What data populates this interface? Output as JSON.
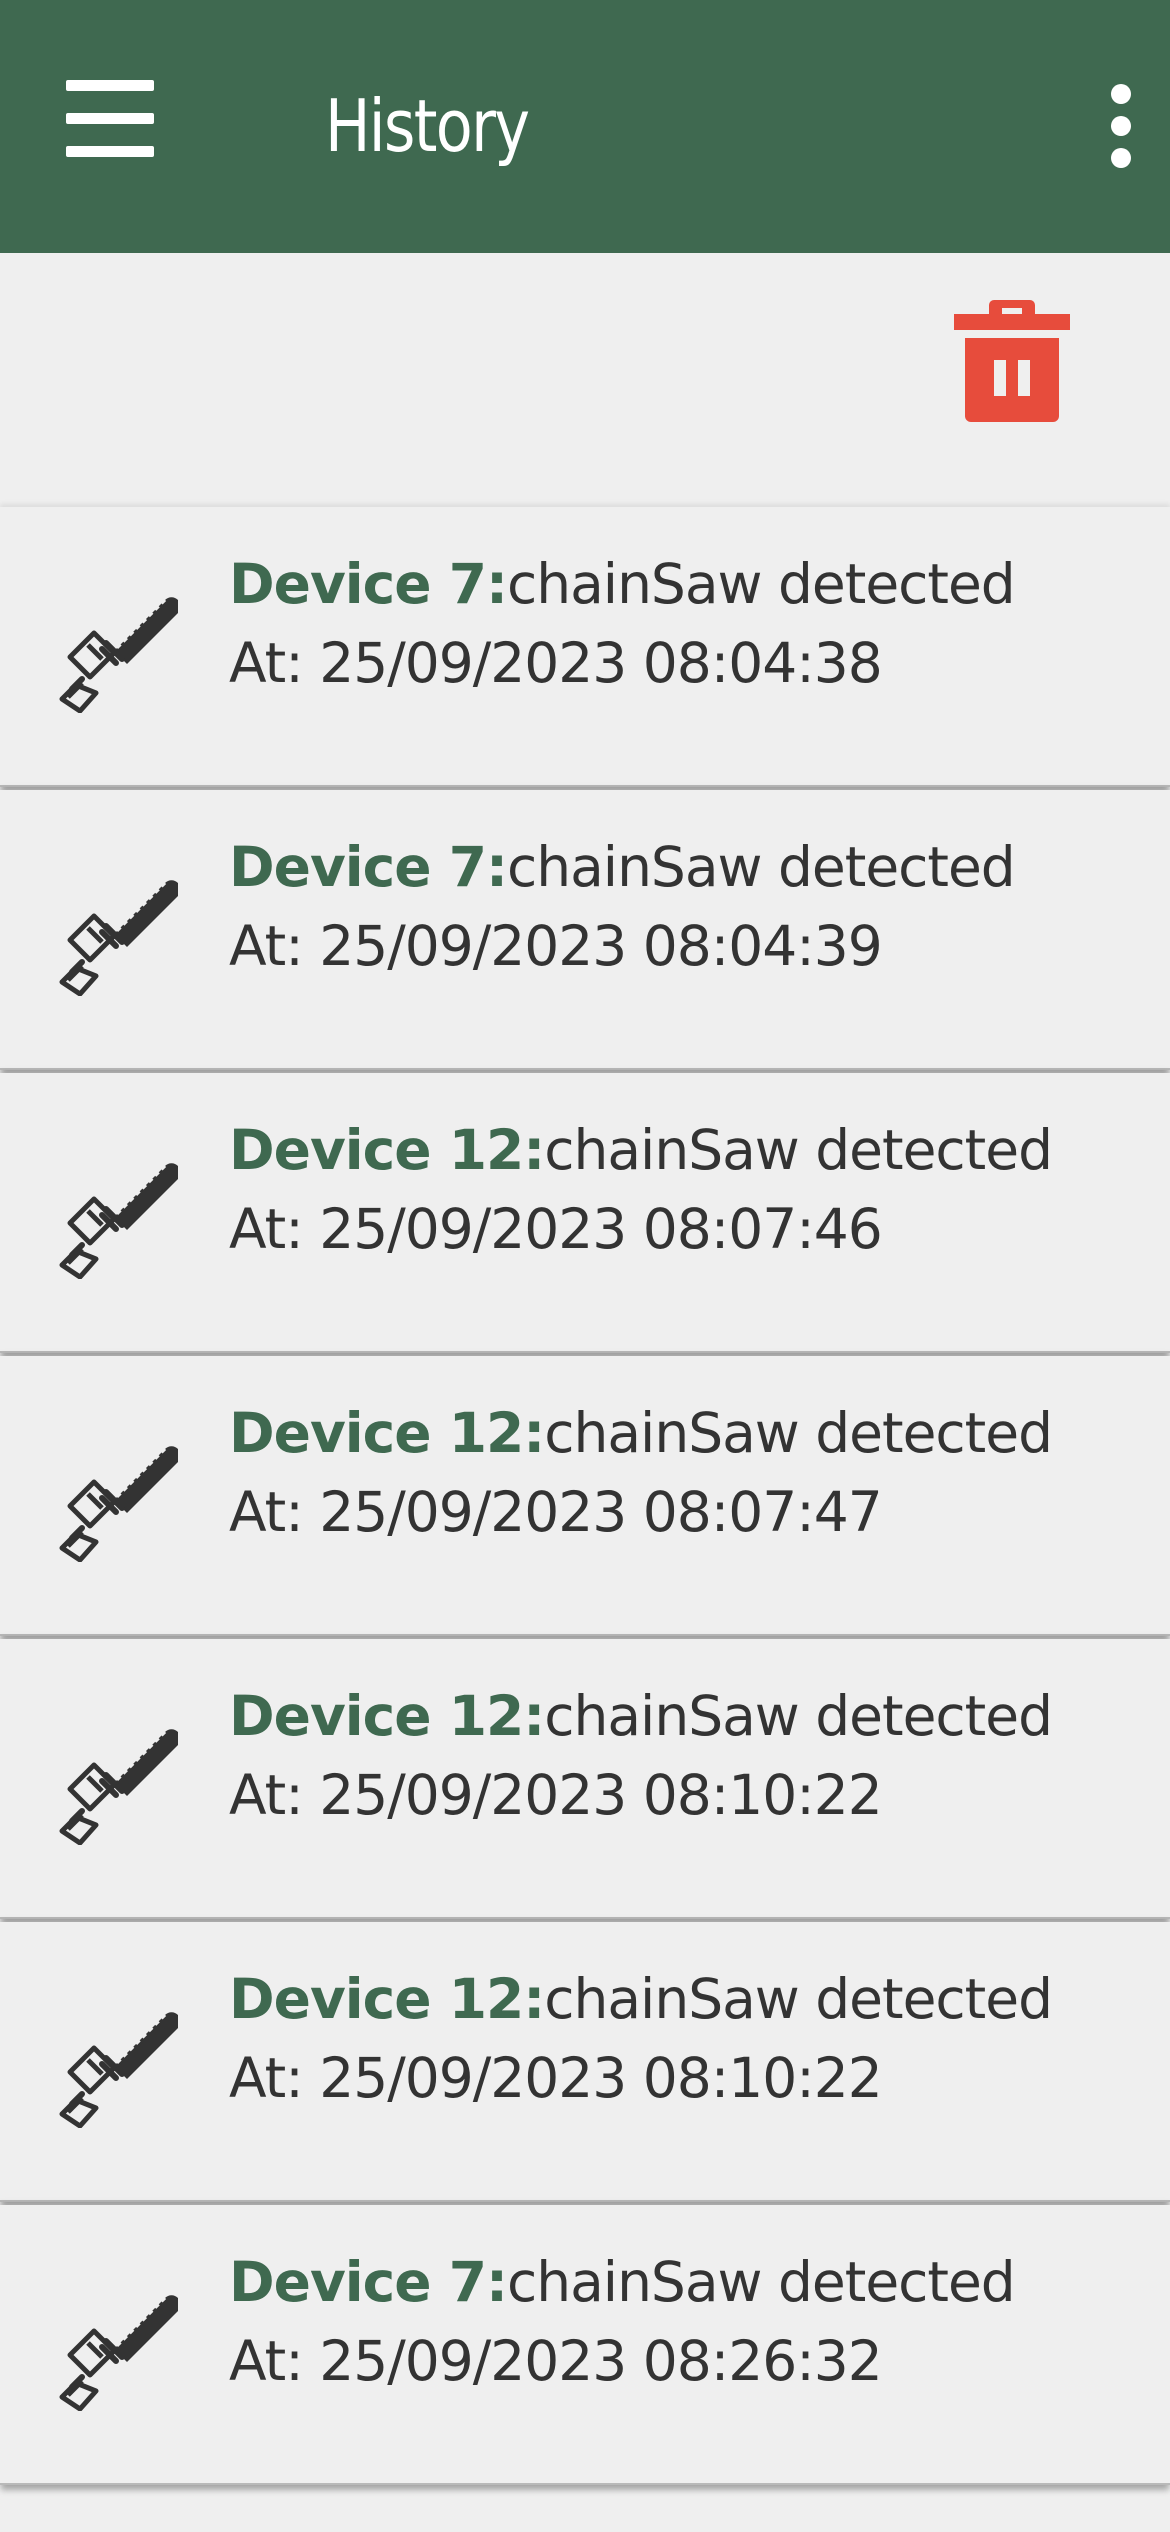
{
  "header": {
    "title": "History",
    "menu_icon": "hamburger-menu-icon",
    "overflow_icon": "more-vertical-icon",
    "background_color": "#3f6950"
  },
  "toolbar": {
    "delete_icon": "trash-icon",
    "delete_color": "#e74c3c"
  },
  "history": {
    "item_icon": "chainsaw-icon",
    "device_color": "#3f6950",
    "items": [
      {
        "device": "Device 7:",
        "event": "chainSaw detected",
        "timestamp": "At: 25/09/2023 08:04:38"
      },
      {
        "device": "Device 7:",
        "event": "chainSaw detected",
        "timestamp": "At: 25/09/2023 08:04:39"
      },
      {
        "device": "Device 12:",
        "event": "chainSaw detected",
        "timestamp": "At: 25/09/2023 08:07:46"
      },
      {
        "device": "Device 12:",
        "event": "chainSaw detected",
        "timestamp": "At: 25/09/2023 08:07:47"
      },
      {
        "device": "Device 12:",
        "event": "chainSaw detected",
        "timestamp": "At: 25/09/2023 08:10:22"
      },
      {
        "device": "Device 12:",
        "event": "chainSaw detected",
        "timestamp": "At: 25/09/2023 08:10:22"
      },
      {
        "device": "Device 7:",
        "event": "chainSaw detected",
        "timestamp": "At: 25/09/2023 08:26:32"
      }
    ]
  }
}
